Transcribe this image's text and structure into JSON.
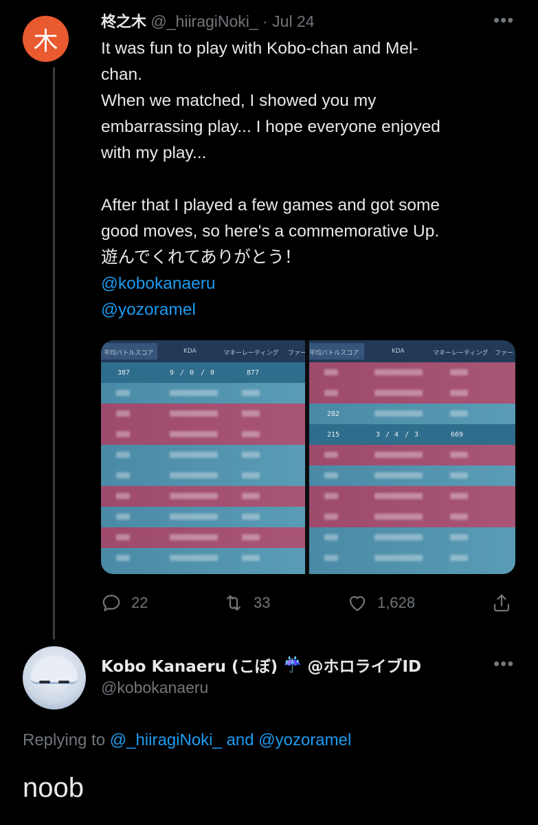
{
  "tweet1": {
    "avatar_glyph": "木",
    "display_name": "柊之木",
    "handle": "@_hiiragiNoki_",
    "separator": "·",
    "date": "Jul 24",
    "more": "•••",
    "lines": [
      "It was fun to play with Kobo-chan and Mel-",
      "chan.",
      "When we matched, I showed you my",
      "embarrassing play... I hope everyone enjoyed",
      "with my play...",
      "After that I played a few games and got some",
      "good moves, so here's a commemorative Up.",
      "遊んでくれてありがとう！"
    ],
    "mentions": [
      "@kobokanaeru",
      "@yozoramel"
    ],
    "stats": {
      "replies": "22",
      "retweets": "33",
      "likes": "1,628"
    },
    "avatar_color": "#ea5a31"
  },
  "media": {
    "left": {
      "headers": [
        "平均バトルスコア",
        "KDA",
        "マネーレーティング",
        "ファー"
      ],
      "highlight_row": [
        "387",
        "9",
        "/",
        "0",
        "/",
        "0",
        "877"
      ]
    },
    "right": {
      "headers": [
        "平均バトルスコア",
        "KDA",
        "マネーレーティング",
        "ファー"
      ],
      "row3_score": "282",
      "highlight_row": [
        "215",
        "3",
        "/",
        "4",
        "/",
        "3",
        "669"
      ]
    }
  },
  "tweet2": {
    "display_name": "Kobo Kanaeru (こぼ)",
    "emoji": "☔",
    "affiliation": "@ホロライブID",
    "handle": "@kobokanaeru",
    "more": "•••",
    "replying_prefix": "Replying to",
    "replying_users": "@_hiiragiNoki_ and @yozoramel",
    "text": "noob"
  },
  "colors": {
    "link": "#1d9bf0",
    "muted": "#71767b",
    "text": "#e7e9ea"
  }
}
